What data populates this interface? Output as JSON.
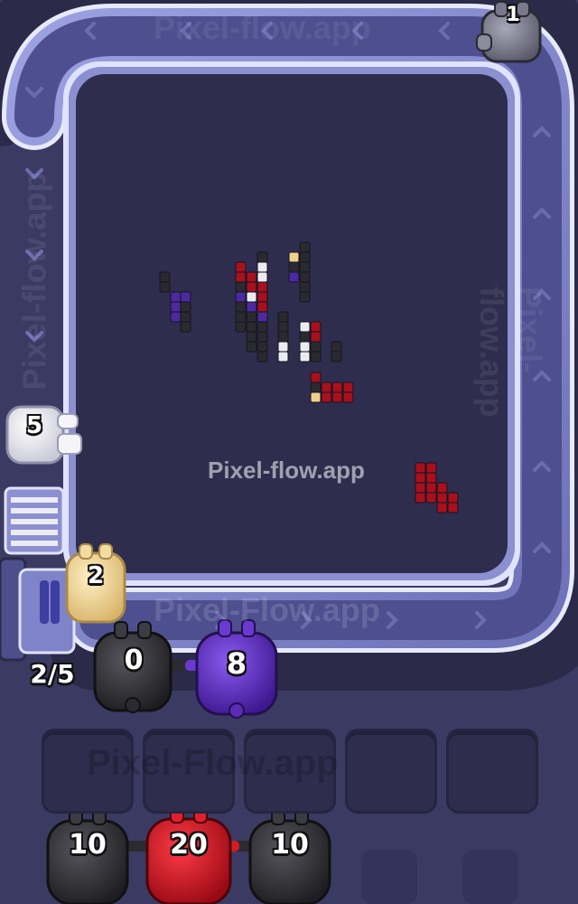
{
  "watermark": {
    "center": "Pixel-flow.app",
    "belt_bottom": "Pixel-Flow.app",
    "belt_top": "Pixel-flow.app",
    "belt_right": "Pixel-flow.app",
    "belt_left": "Pixel-flow.app",
    "queue_area": "Pixel-Flow.app"
  },
  "belt_units": {
    "gray_top_right": {
      "count": "1",
      "color": "#6f6e80"
    },
    "white_left": {
      "count": "5",
      "color": "#f2f2f5"
    },
    "cream_feeder": {
      "count": "2",
      "color": "#f1d48f"
    }
  },
  "launcher": {
    "progress": "2/5",
    "used": 2,
    "total": 5
  },
  "active_pair": [
    {
      "count": "0",
      "color": "#2b2b30"
    },
    {
      "count": "8",
      "color": "#5a2bb5"
    }
  ],
  "slots": {
    "count": 5,
    "capacity_used": 0
  },
  "queue": [
    {
      "count": "10",
      "color": "#2b2b30"
    },
    {
      "count": "20",
      "color": "#c0121e"
    },
    {
      "count": "10",
      "color": "#2b2b30"
    }
  ],
  "palette": {
    "background": "#3b3a63",
    "track": "#8c8fd0",
    "track_outline": "#dfe3ff",
    "board": "#2e2d4e",
    "black_pixel": "#2a2a2e",
    "red_pixel": "#a8101c",
    "purple_pixel": "#4b2aa0",
    "white_pixel": "#ececf0",
    "cream_pixel": "#f0d08a"
  }
}
